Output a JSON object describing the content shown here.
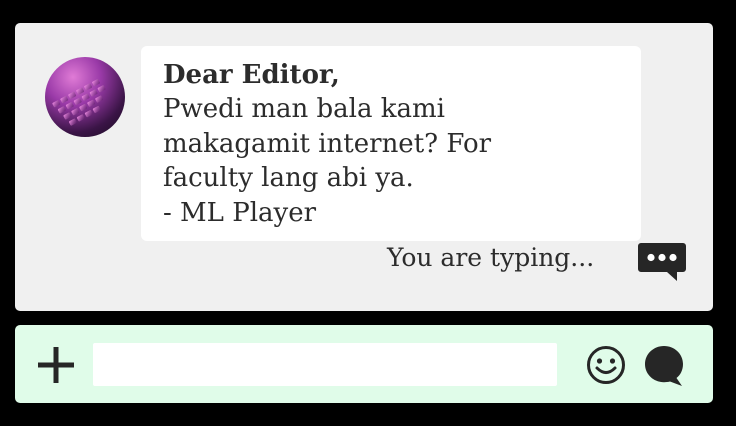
{
  "message": {
    "greeting": "Dear Editor,",
    "lines": [
      "Pwedi man bala kami",
      "makagamit internet? For",
      "faculty lang abi ya.",
      "- ML Player"
    ]
  },
  "status": {
    "typing": "You are typing..."
  },
  "composer": {
    "input_value": "",
    "input_placeholder": ""
  },
  "icons": {
    "avatar": "keyboard-photo-avatar",
    "typing": "typing-speech-bubble-icon",
    "add": "plus-icon",
    "emoji": "smiley-face-icon",
    "send": "speech-bubble-send-icon"
  },
  "colors": {
    "background": "#000000",
    "chat_panel": "#f0f0f0",
    "bubble": "#ffffff",
    "input_bar": "#e0fce9",
    "text": "#2c2c2c",
    "icon": "#262626"
  }
}
